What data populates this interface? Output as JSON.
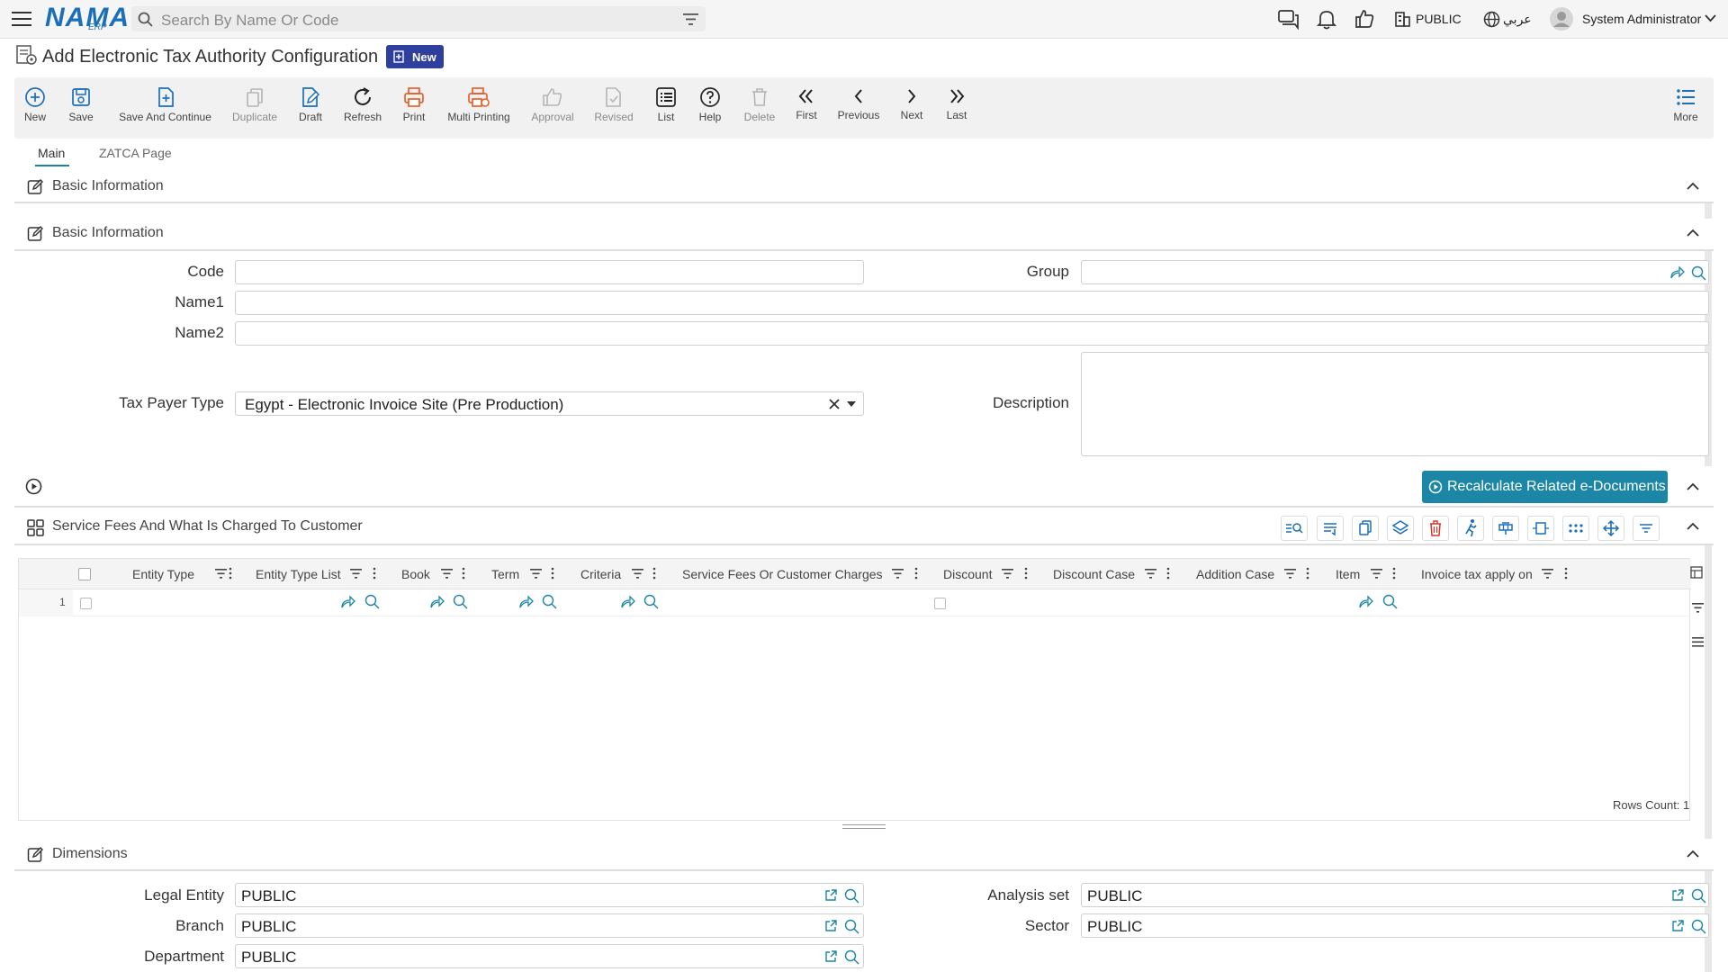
{
  "topbar": {
    "logo_main": "NAMA",
    "logo_sub": "ERP",
    "search_placeholder": "Search By Name Or Code",
    "company": "PUBLIC",
    "language": "عربي",
    "user": "System Administrator"
  },
  "page": {
    "title": "Add Electronic Tax Authority Configuration",
    "status_badge": "New"
  },
  "toolbar": {
    "buttons": [
      {
        "label": "New",
        "icon": "plus-circle-icon"
      },
      {
        "label": "Save",
        "icon": "save-icon"
      },
      {
        "label": "Save And Continue",
        "icon": "save-continue-icon"
      },
      {
        "label": "Duplicate",
        "icon": "duplicate-icon"
      },
      {
        "label": "Draft",
        "icon": "draft-icon"
      },
      {
        "label": "Refresh",
        "icon": "refresh-icon"
      },
      {
        "label": "Print",
        "icon": "print-icon"
      },
      {
        "label": "Multi Printing",
        "icon": "multi-print-icon"
      },
      {
        "label": "Approval",
        "icon": "thumbs-up-icon"
      },
      {
        "label": "Revised",
        "icon": "revised-icon"
      },
      {
        "label": "List",
        "icon": "list-icon"
      },
      {
        "label": "Help",
        "icon": "help-icon"
      },
      {
        "label": "Delete",
        "icon": "trash-icon"
      },
      {
        "label": "First",
        "icon": "double-chevron-left-icon"
      },
      {
        "label": "Previous",
        "icon": "chevron-left-icon"
      },
      {
        "label": "Next",
        "icon": "chevron-right-icon"
      },
      {
        "label": "Last",
        "icon": "double-chevron-right-icon"
      },
      {
        "label": "More",
        "icon": "more-list-icon"
      }
    ]
  },
  "tabs": [
    {
      "label": "Main",
      "active": true
    },
    {
      "label": "ZATCA Page",
      "active": false
    }
  ],
  "sections": {
    "basic_outer": "Basic Information",
    "basic_inner": "Basic Information",
    "service_fees": "Service Fees And What Is Charged To Customer",
    "dimensions": "Dimensions"
  },
  "form": {
    "code_label": "Code",
    "code_value": "",
    "group_label": "Group",
    "group_value": "",
    "name1_label": "Name1",
    "name1_value": "",
    "name2_label": "Name2",
    "name2_value": "",
    "tax_payer_type_label": "Tax Payer Type",
    "tax_payer_type_value": "Egypt - Electronic Invoice Site (Pre Production)",
    "description_label": "Description",
    "description_value": ""
  },
  "recalc_button": "Recalculate Related e-Documents",
  "grid": {
    "columns": [
      "Entity Type",
      "Entity Type List",
      "Book",
      "Term",
      "Criteria",
      "Service Fees Or Customer Charges",
      "Discount",
      "Discount Case",
      "Addition Case",
      "Item",
      "Invoice tax apply on"
    ],
    "rows": [
      {
        "num": "1"
      }
    ],
    "rows_count": "Rows Count: 1"
  },
  "dimensions": {
    "legal_entity_label": "Legal Entity",
    "legal_entity_value": "PUBLIC",
    "branch_label": "Branch",
    "branch_value": "PUBLIC",
    "department_label": "Department",
    "department_value": "PUBLIC",
    "analysis_set_label": "Analysis set",
    "analysis_set_value": "PUBLIC",
    "sector_label": "Sector",
    "sector_value": "PUBLIC"
  },
  "colors": {
    "accent": "#1b86a6",
    "badge": "#2e3f9e",
    "logo": "#1a6fb8",
    "print_orange": "#e8602c"
  }
}
